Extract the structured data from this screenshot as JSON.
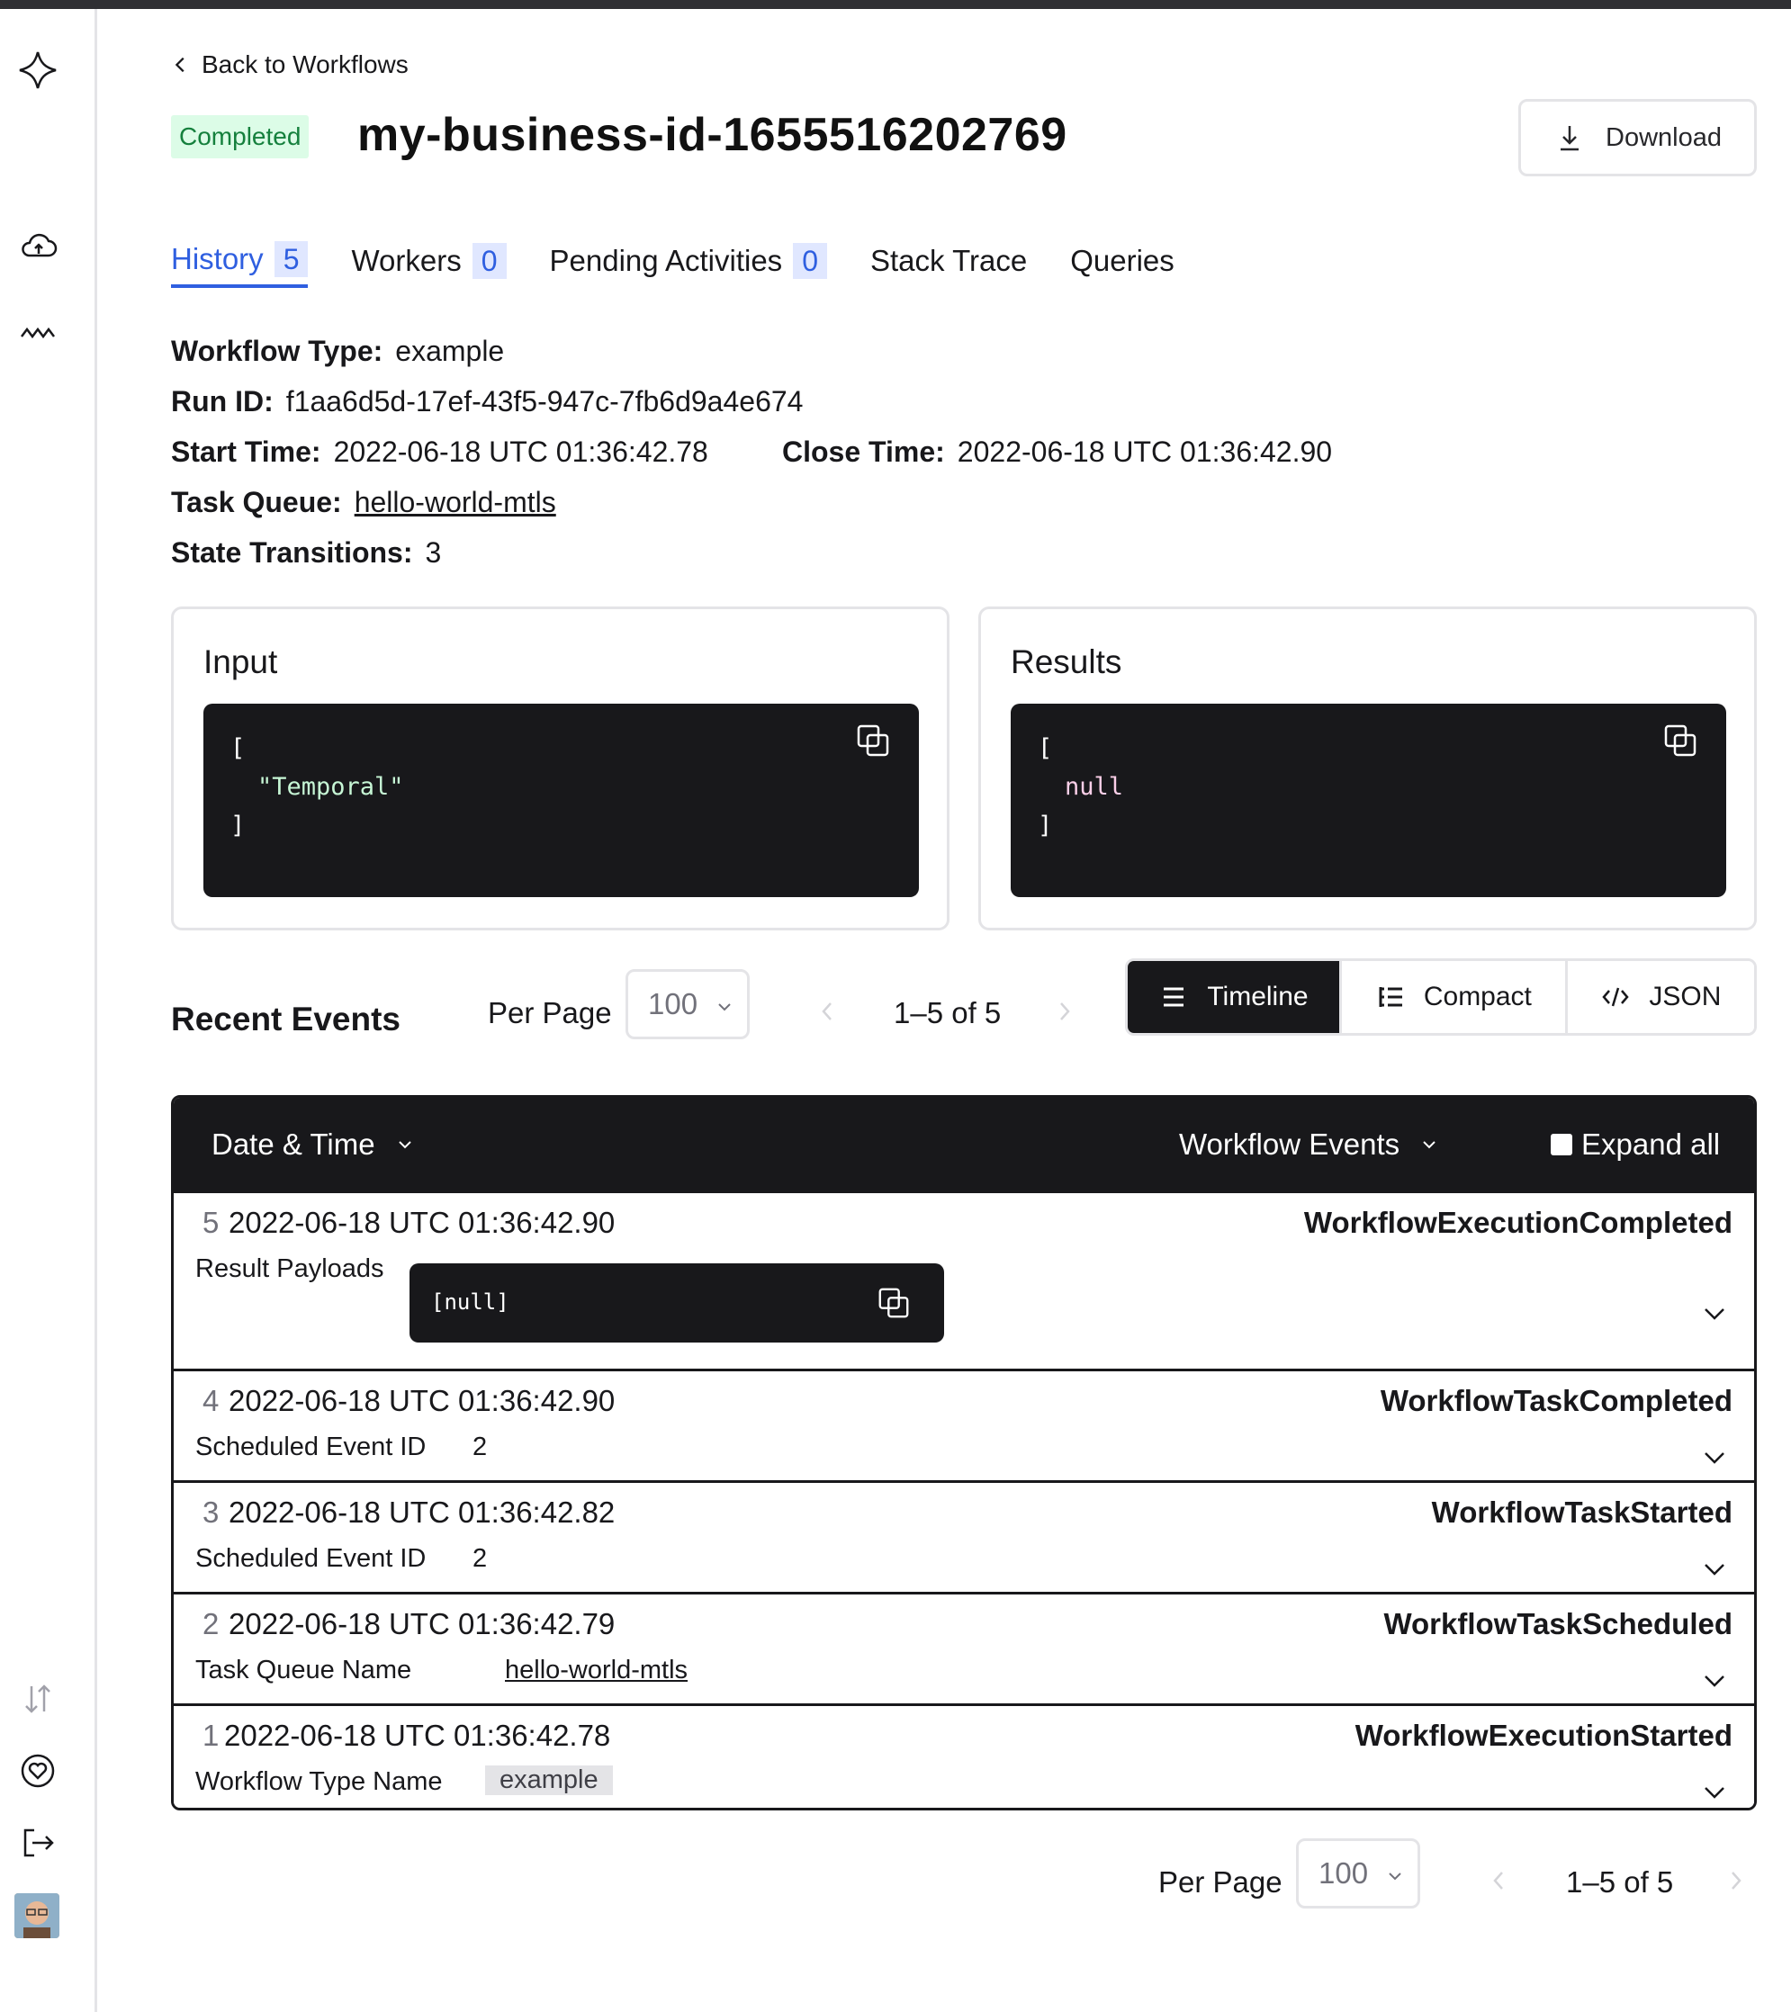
{
  "nav": {
    "icons": [
      "temporal-logo-icon",
      "cloud-icon",
      "activity-icon",
      "sort-icon",
      "heart-icon",
      "logout-icon"
    ]
  },
  "header": {
    "back_label": "Back to Workflows",
    "status": "Completed",
    "title": "my-business-id-1655516202769",
    "download_label": "Download"
  },
  "tabs": [
    {
      "label": "History",
      "count": "5",
      "active": true
    },
    {
      "label": "Workers",
      "count": "0"
    },
    {
      "label": "Pending Activities",
      "count": "0"
    },
    {
      "label": "Stack Trace"
    },
    {
      "label": "Queries"
    }
  ],
  "meta": {
    "workflow_type_label": "Workflow Type:",
    "workflow_type": "example",
    "run_id_label": "Run ID:",
    "run_id": "f1aa6d5d-17ef-43f5-947c-7fb6d9a4e674",
    "start_time_label": "Start Time:",
    "start_time": "2022-06-18 UTC 01:36:42.78",
    "close_time_label": "Close Time:",
    "close_time": "2022-06-18 UTC 01:36:42.90",
    "task_queue_label": "Task Queue:",
    "task_queue": "hello-world-mtls",
    "state_transitions_label": "State Transitions:",
    "state_transitions": "3"
  },
  "input": {
    "title": "Input",
    "open": "[",
    "value": "\"Temporal\"",
    "close": "]"
  },
  "results": {
    "title": "Results",
    "open": "[",
    "value": "null",
    "close": "]"
  },
  "recent_events": {
    "title": "Recent Events",
    "per_page_label": "Per Page",
    "per_page_value": "100",
    "range": "1–5 of 5",
    "views": [
      {
        "label": "Timeline",
        "active": true
      },
      {
        "label": "Compact"
      },
      {
        "label": "JSON"
      }
    ]
  },
  "table": {
    "col_date": "Date & Time",
    "col_events": "Workflow Events",
    "expand_all": "Expand all",
    "rows": [
      {
        "id": "5",
        "time": "2022-06-18 UTC 01:36:42.90",
        "type": "WorkflowExecutionCompleted",
        "key": "Result Payloads",
        "value": "[null]"
      },
      {
        "id": "4",
        "time": "2022-06-18 UTC 01:36:42.90",
        "type": "WorkflowTaskCompleted",
        "key": "Scheduled Event ID",
        "value": "2"
      },
      {
        "id": "3",
        "time": "2022-06-18 UTC 01:36:42.82",
        "type": "WorkflowTaskStarted",
        "key": "Scheduled Event ID",
        "value": "2"
      },
      {
        "id": "2",
        "time": "2022-06-18 UTC 01:36:42.79",
        "type": "WorkflowTaskScheduled",
        "key": "Task Queue Name",
        "value": "hello-world-mtls"
      },
      {
        "id": "1",
        "time": "2022-06-18 UTC 01:36:42.78",
        "type": "WorkflowExecutionStarted",
        "key": "Workflow Type Name",
        "value": "example"
      }
    ]
  },
  "footer_pager": {
    "per_page_label": "Per Page",
    "per_page_value": "100",
    "range": "1–5 of 5"
  },
  "colors": {
    "accent": "#2f5fe0",
    "status_green_bg": "#dcfce7",
    "status_green_text": "#15803d",
    "dark": "#18181b"
  }
}
